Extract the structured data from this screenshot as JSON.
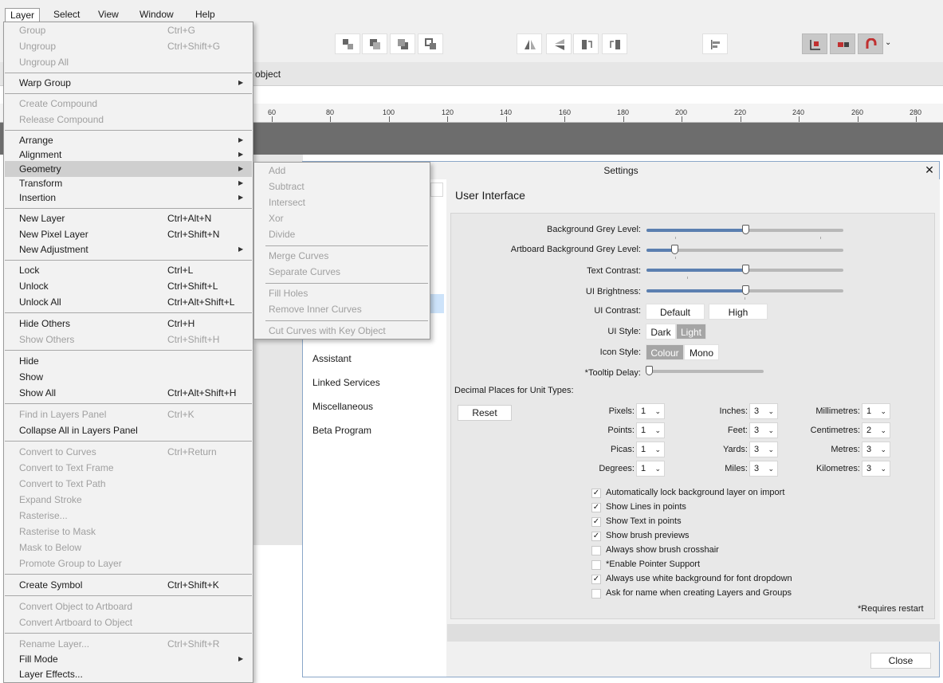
{
  "menubar": {
    "items": [
      "Layer",
      "Select",
      "View",
      "Window",
      "Help"
    ]
  },
  "context_bar": {
    "text": "object"
  },
  "ruler": {
    "labels": [
      "60",
      "80",
      "100",
      "120",
      "140",
      "160",
      "180",
      "200",
      "220",
      "240",
      "260",
      "280"
    ]
  },
  "layer_menu": {
    "items": [
      {
        "label": "Group",
        "shortcut": "Ctrl+G",
        "disabled": true
      },
      {
        "label": "Ungroup",
        "shortcut": "Ctrl+Shift+G",
        "disabled": true
      },
      {
        "label": "Ungroup All",
        "shortcut": "",
        "disabled": true
      },
      {
        "label": "Warp Group",
        "shortcut": "",
        "submenu": true
      },
      {
        "label": "Create Compound",
        "shortcut": "",
        "disabled": true
      },
      {
        "label": "Release Compound",
        "shortcut": "",
        "disabled": true
      },
      {
        "label": "Arrange",
        "shortcut": "",
        "submenu": true
      },
      {
        "label": "Alignment",
        "shortcut": "",
        "submenu": true
      },
      {
        "label": "Geometry",
        "shortcut": "",
        "submenu": true,
        "highlighted": true
      },
      {
        "label": "Transform",
        "shortcut": "",
        "submenu": true
      },
      {
        "label": "Insertion",
        "shortcut": "",
        "submenu": true
      },
      {
        "label": "New Layer",
        "shortcut": "Ctrl+Alt+N"
      },
      {
        "label": "New Pixel Layer",
        "shortcut": "Ctrl+Shift+N"
      },
      {
        "label": "New Adjustment",
        "shortcut": "",
        "submenu": true
      },
      {
        "label": "Lock",
        "shortcut": "Ctrl+L"
      },
      {
        "label": "Unlock",
        "shortcut": "Ctrl+Shift+L"
      },
      {
        "label": "Unlock All",
        "shortcut": "Ctrl+Alt+Shift+L"
      },
      {
        "label": "Hide Others",
        "shortcut": "Ctrl+H"
      },
      {
        "label": "Show Others",
        "shortcut": "Ctrl+Shift+H",
        "disabled": true
      },
      {
        "label": "Hide",
        "shortcut": ""
      },
      {
        "label": "Show",
        "shortcut": ""
      },
      {
        "label": "Show All",
        "shortcut": "Ctrl+Alt+Shift+H"
      },
      {
        "label": "Find in Layers Panel",
        "shortcut": "Ctrl+K",
        "disabled": true
      },
      {
        "label": "Collapse All in Layers Panel",
        "shortcut": ""
      },
      {
        "label": "Convert to Curves",
        "shortcut": "Ctrl+Return",
        "disabled": true
      },
      {
        "label": "Convert to Text Frame",
        "shortcut": "",
        "disabled": true
      },
      {
        "label": "Convert to Text Path",
        "shortcut": "",
        "disabled": true
      },
      {
        "label": "Expand Stroke",
        "shortcut": "",
        "disabled": true
      },
      {
        "label": "Rasterise...",
        "shortcut": "",
        "disabled": true
      },
      {
        "label": "Rasterise to Mask",
        "shortcut": "",
        "disabled": true
      },
      {
        "label": "Mask to Below",
        "shortcut": "",
        "disabled": true
      },
      {
        "label": "Promote Group to Layer",
        "shortcut": "",
        "disabled": true
      },
      {
        "label": "Create Symbol",
        "shortcut": "Ctrl+Shift+K"
      },
      {
        "label": "Convert Object to Artboard",
        "shortcut": "",
        "disabled": true
      },
      {
        "label": "Convert Artboard to Object",
        "shortcut": "",
        "disabled": true
      },
      {
        "label": "Rename Layer...",
        "shortcut": "Ctrl+Shift+R",
        "disabled": true
      },
      {
        "label": "Fill Mode",
        "shortcut": "",
        "submenu": true
      },
      {
        "label": "Layer Effects...",
        "shortcut": ""
      }
    ]
  },
  "geometry_menu": {
    "items": [
      "Add",
      "Subtract",
      "Intersect",
      "Xor",
      "Divide",
      "Merge Curves",
      "Separate Curves",
      "Fill Holes",
      "Remove Inner Curves",
      "Cut Curves with Key Object"
    ]
  },
  "settings": {
    "title": "Settings",
    "close_x": "✕",
    "nav": [
      "Assistant",
      "Linked Services",
      "Miscellaneous",
      "Beta Program"
    ],
    "section_title": "User Interface",
    "sliders": [
      {
        "label": "Background Grey Level:",
        "value": 0.5
      },
      {
        "label": "Artboard Background Grey Level:",
        "value": 0.14
      },
      {
        "label": "Text Contrast:",
        "value": 0.5
      },
      {
        "label": "UI Brightness:",
        "value": 0.5
      }
    ],
    "ui_contrast": {
      "label": "UI Contrast:",
      "options": [
        "Default",
        "High"
      ]
    },
    "ui_style": {
      "label": "UI Style:",
      "options": [
        "Dark",
        "Light"
      ],
      "selected": "Light"
    },
    "icon_style": {
      "label": "Icon Style:",
      "options": [
        "Colour",
        "Mono"
      ],
      "selected": "Colour"
    },
    "tooltip_delay": {
      "label": "*Tooltip Delay:",
      "value": 0.02
    },
    "decimal_places_label": "Decimal Places for Unit Types:",
    "reset_label": "Reset",
    "units": [
      {
        "label": "Pixels:",
        "value": "1"
      },
      {
        "label": "Inches:",
        "value": "3"
      },
      {
        "label": "Millimetres:",
        "value": "1"
      },
      {
        "label": "Points:",
        "value": "1"
      },
      {
        "label": "Feet:",
        "value": "3"
      },
      {
        "label": "Centimetres:",
        "value": "2"
      },
      {
        "label": "Picas:",
        "value": "1"
      },
      {
        "label": "Yards:",
        "value": "3"
      },
      {
        "label": "Metres:",
        "value": "3"
      },
      {
        "label": "Degrees:",
        "value": "1"
      },
      {
        "label": "Miles:",
        "value": "3"
      },
      {
        "label": "Kilometres:",
        "value": "3"
      }
    ],
    "checkboxes": [
      {
        "label": "Automatically lock background layer on import",
        "checked": true
      },
      {
        "label": "Show Lines in points",
        "checked": true
      },
      {
        "label": "Show Text in points",
        "checked": true
      },
      {
        "label": "Show brush previews",
        "checked": true
      },
      {
        "label": "Always show brush crosshair",
        "checked": false
      },
      {
        "label": "*Enable Pointer Support",
        "checked": false
      },
      {
        "label": "Always use white background for font dropdown",
        "checked": true
      },
      {
        "label": "Ask for name when creating Layers and Groups",
        "checked": false
      }
    ],
    "requires_restart": "*Requires restart",
    "close_label": "Close"
  },
  "colors": {
    "accent": "#5b7fb0",
    "menu_highlight": "#cfcfcf",
    "selected_nav": "#cde3fa"
  }
}
